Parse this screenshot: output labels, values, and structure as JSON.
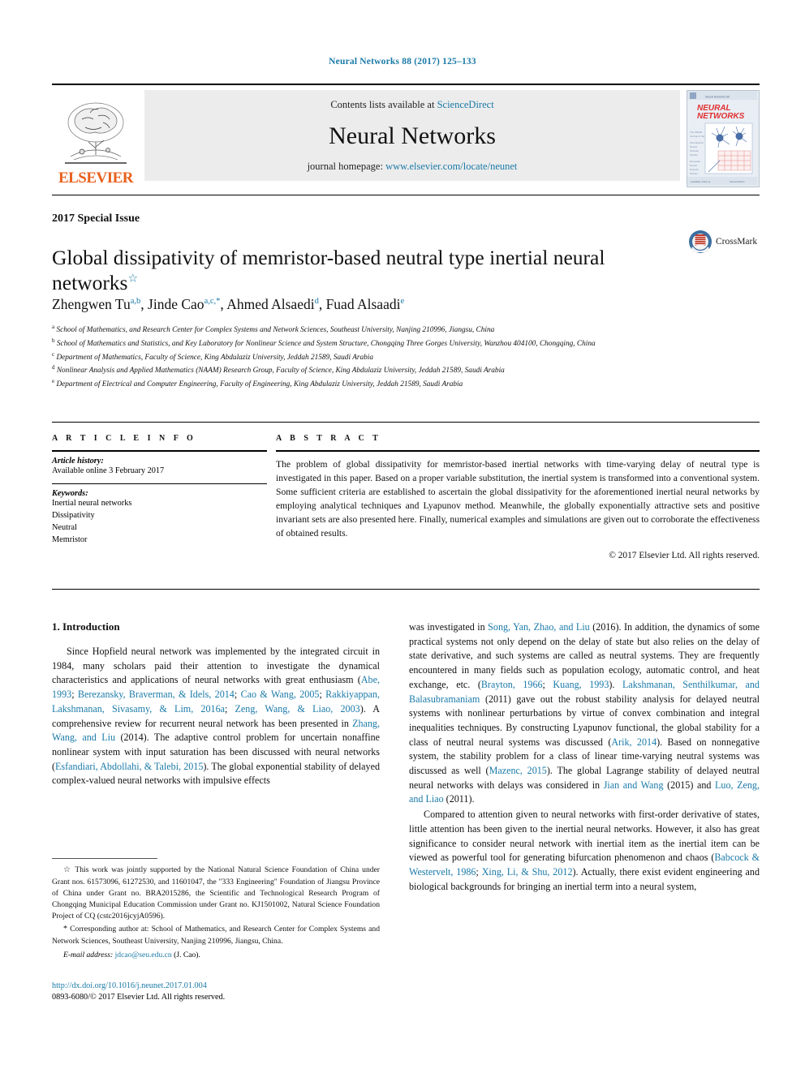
{
  "running_head": "Neural Networks 88 (2017) 125–133",
  "masthead": {
    "publisher_name": "ELSEVIER",
    "contents_text": "Contents lists available at",
    "sciencedirect": "ScienceDirect",
    "journal_title": "Neural Networks",
    "homepage_label": "journal homepage:",
    "homepage_url": "www.elsevier.com/locate/neunet",
    "cover_title_line1": "NEURAL",
    "cover_title_line2": "NETWORKS"
  },
  "article": {
    "special_issue": "2017 Special Issue",
    "title": "Global dissipativity of memristor-based neutral type inertial neural networks",
    "title_footnote_marker": "☆",
    "crossmark_label": "CrossMark",
    "authors": [
      {
        "name": "Zhengwen Tu",
        "marks": "a,b"
      },
      {
        "name": "Jinde Cao",
        "marks": "a,c,*"
      },
      {
        "name": "Ahmed Alsaedi",
        "marks": "d"
      },
      {
        "name": "Fuad Alsaadi",
        "marks": "e"
      }
    ],
    "affiliations": [
      {
        "mark": "a",
        "text": "School of Mathematics, and Research Center for Complex Systems and Network Sciences, Southeast University, Nanjing 210996, Jiangsu, China"
      },
      {
        "mark": "b",
        "text": "School of Mathematics and Statistics, and Key Laboratory for Nonlinear Science and System Structure, Chongqing Three Gorges University, Wanzhou 404100, Chongqing, China"
      },
      {
        "mark": "c",
        "text": "Department of Mathematics, Faculty of Science, King Abdulaziz University, Jeddah 21589, Saudi Arabia"
      },
      {
        "mark": "d",
        "text": "Nonlinear Analysis and Applied Mathematics (NAAM) Research Group, Faculty of Science, King Abdulaziz University, Jeddah 21589, Saudi Arabia"
      },
      {
        "mark": "e",
        "text": "Department of Electrical and Computer Engineering, Faculty of Engineering, King Abdulaziz University, Jeddah 21589, Saudi Arabia"
      }
    ]
  },
  "article_info": {
    "heading": "A R T I C L E    I N F O",
    "history_label": "Article history:",
    "history_value": "Available online 3 February 2017",
    "keywords_label": "Keywords:",
    "keywords": [
      "Inertial neural networks",
      "Dissipativity",
      "Neutral",
      "Memristor"
    ]
  },
  "abstract": {
    "heading": "A B S T R A C T",
    "text": "The problem of global dissipativity for memristor-based inertial networks with time-varying delay of neutral type is investigated in this paper. Based on a proper variable substitution, the inertial system is transformed into a conventional system. Some sufficient criteria are established to ascertain the global dissipativity for the aforementioned inertial neural networks by employing analytical techniques and Lyapunov method. Meanwhile, the globally exponentially attractive sets and positive invariant sets are also presented here. Finally, numerical examples and simulations are given out to corroborate the effectiveness of obtained results.",
    "copyright": "© 2017 Elsevier Ltd. All rights reserved."
  },
  "body": {
    "section_number_title": "1. Introduction",
    "left_paragraph_1_parts": [
      {
        "t": "Since Hopfield neural network was implemented by the integrated circuit in 1984, many scholars paid their attention to investigate the dynamical characteristics and applications of neural networks with great enthusiasm (",
        "link": false
      },
      {
        "t": "Abe, 1993",
        "link": true
      },
      {
        "t": "; ",
        "link": false
      },
      {
        "t": "Berezansky, Braverman, & Idels, 2014",
        "link": true
      },
      {
        "t": "; ",
        "link": false
      },
      {
        "t": "Cao & Wang, 2005",
        "link": true
      },
      {
        "t": "; ",
        "link": false
      },
      {
        "t": "Rakkiyappan, Lakshmanan, Sivasamy, & Lim, 2016a",
        "link": true
      },
      {
        "t": "; ",
        "link": false
      },
      {
        "t": "Zeng, Wang, & Liao, 2003",
        "link": true
      },
      {
        "t": "). A comprehensive review for recurrent neural network has been presented in ",
        "link": false
      },
      {
        "t": "Zhang, Wang, and Liu",
        "link": true
      },
      {
        "t": " (2014)",
        "link": false
      },
      {
        "t": ". The adaptive control problem for uncertain nonaffine nonlinear system with input saturation has been discussed with neural networks (",
        "link": false
      },
      {
        "t": "Esfandiari, Abdollahi, & Talebi, 2015",
        "link": true
      },
      {
        "t": "). The global exponential stability of delayed complex-valued neural networks with impulsive effects",
        "link": false
      }
    ],
    "right_paragraph_1_parts": [
      {
        "t": "was investigated in ",
        "link": false
      },
      {
        "t": "Song, Yan, Zhao, and Liu",
        "link": true
      },
      {
        "t": " (2016)",
        "link": false
      },
      {
        "t": ". In addition, the dynamics of some practical systems not only depend on the delay of state but also relies on the delay of state derivative, and such systems are called as neutral systems. They are frequently encountered in many fields such as population ecology, automatic control, and heat exchange, etc. (",
        "link": false
      },
      {
        "t": "Brayton, 1966",
        "link": true
      },
      {
        "t": "; ",
        "link": false
      },
      {
        "t": "Kuang, 1993",
        "link": true
      },
      {
        "t": "). ",
        "link": false
      },
      {
        "t": "Lakshmanan, Senthilkumar, and Balasubramaniam",
        "link": true
      },
      {
        "t": " (2011)",
        "link": false
      },
      {
        "t": " gave out the robust stability analysis for delayed neutral systems with nonlinear perturbations by virtue of convex combination and integral inequalities techniques. By constructing Lyapunov functional, the global stability for a class of neutral neural systems was discussed (",
        "link": false
      },
      {
        "t": "Arik, 2014",
        "link": true
      },
      {
        "t": "). Based on nonnegative system, the stability problem for a class of linear time-varying neutral systems was discussed as well (",
        "link": false
      },
      {
        "t": "Mazenc, 2015",
        "link": true
      },
      {
        "t": "). The global Lagrange stability of delayed neutral neural networks with delays was considered in ",
        "link": false
      },
      {
        "t": "Jian and Wang",
        "link": true
      },
      {
        "t": " (2015)",
        "link": false
      },
      {
        "t": " and ",
        "link": false
      },
      {
        "t": "Luo, Zeng, and Liao",
        "link": true
      },
      {
        "t": " (2011)",
        "link": false
      },
      {
        "t": ".",
        "link": false
      }
    ],
    "right_paragraph_2_parts": [
      {
        "t": "Compared to attention given to neural networks with first-order derivative of states, little attention has been given to the inertial neural networks. However, it also has great significance to consider neural network with inertial item as the inertial item can be viewed as powerful tool for generating bifurcation phenomenon and chaos (",
        "link": false
      },
      {
        "t": "Babcock & Westervelt, 1986",
        "link": true
      },
      {
        "t": "; ",
        "link": false
      },
      {
        "t": "Xing, Li, & Shu, 2012",
        "link": true
      },
      {
        "t": "). Actually, there exist evident engineering and biological backgrounds for bringing an inertial term into a neural system,",
        "link": false
      }
    ]
  },
  "footnotes": {
    "funding": "This work was jointly supported by the National Natural Science Foundation of China under Grant nos. 61573096, 61272530, and 11601047, the \"333 Engineering\" Foundation of Jiangsu Province of China under Grant no. BRA2015286, the Scientific and Technological Research Program of Chongqing Municipal Education Commission under Grant no. KJ1501002, Natural Science Foundation Project of CQ (cstc2016jcyjA0596).",
    "corresponding": "Corresponding author at: School of Mathematics, and Research Center for Complex Systems and Network Sciences, Southeast University, Nanjing 210996, Jiangsu, China.",
    "email_label": "E-mail address:",
    "email": "jdcao@seu.edu.cn",
    "email_owner": "(J. Cao).",
    "doi": "http://dx.doi.org/10.1016/j.neunet.2017.01.004",
    "issn_line": "0893-6080/© 2017 Elsevier Ltd. All rights reserved."
  },
  "colors": {
    "link": "#1a7aa8",
    "elsevier_orange": "#e8601c",
    "cover_red": "#e03030",
    "cover_blue": "#4a6fa8"
  }
}
